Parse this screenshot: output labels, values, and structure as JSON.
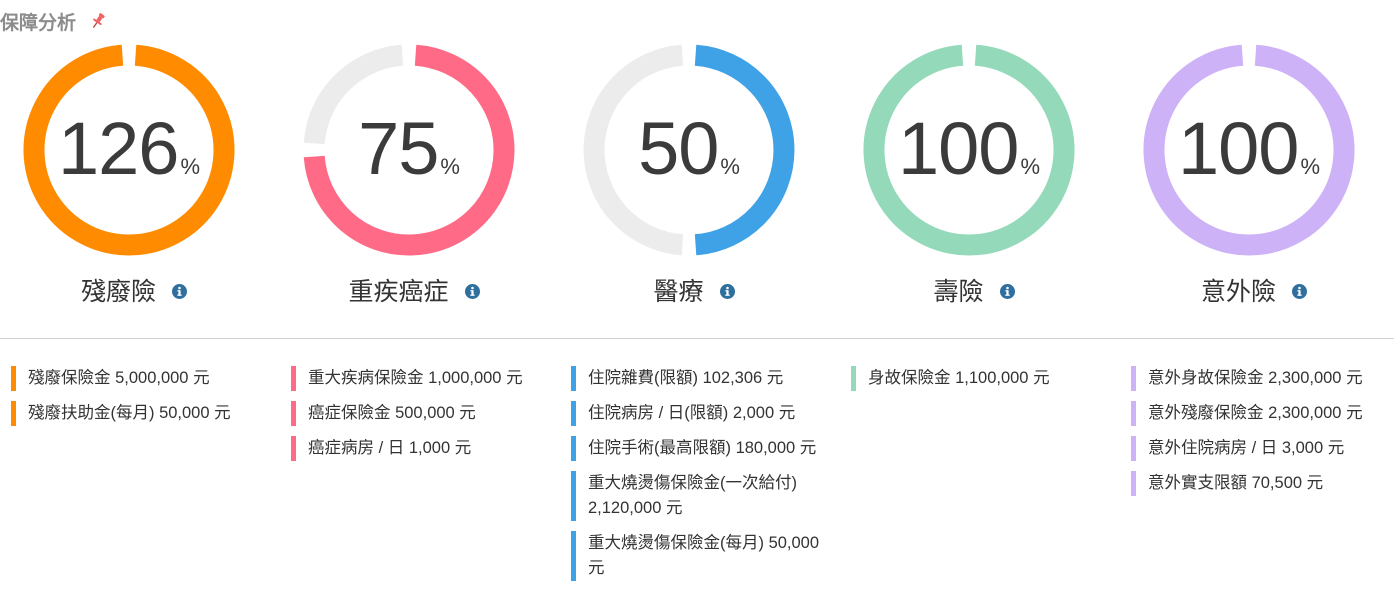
{
  "header": {
    "title": "保障分析",
    "pin_icon": "pin-icon"
  },
  "chart_data": {
    "type": "donut",
    "value_unit": "%",
    "series": [
      {
        "name": "殘廢險",
        "value": 126,
        "color": "#ff8c00",
        "track": "#ececec"
      },
      {
        "name": "重疾癌症",
        "value": 75,
        "color": "#ff6b87",
        "track": "#ececec"
      },
      {
        "name": "醫療",
        "value": 50,
        "color": "#3fa2e6",
        "track": "#ececec"
      },
      {
        "name": "壽險",
        "value": 100,
        "color": "#94d9ba",
        "track": "#ececec"
      },
      {
        "name": "意外險",
        "value": 100,
        "color": "#cdb2f7",
        "track": "#ececec"
      }
    ]
  },
  "details": [
    {
      "color": "#ff8c00",
      "items": [
        "殘廢保險金 5,000,000 元",
        "殘廢扶助金(每月) 50,000 元"
      ]
    },
    {
      "color": "#ff6b87",
      "items": [
        "重大疾病保險金 1,000,000 元",
        "癌症保險金 500,000 元",
        "癌症病房 / 日 1,000 元"
      ]
    },
    {
      "color": "#3fa2e6",
      "items": [
        "住院雜費(限額) 102,306 元",
        "住院病房 / 日(限額) 2,000 元",
        "住院手術(最高限額) 180,000 元",
        "重大燒燙傷保險金(一次給付) 2,120,000 元",
        "重大燒燙傷保險金(每月) 50,000 元"
      ]
    },
    {
      "color": "#94d9ba",
      "items": [
        "身故保險金 1,100,000 元"
      ]
    },
    {
      "color": "#cdb2f7",
      "items": [
        "意外身故保險金 2,300,000 元",
        "意外殘廢保險金 2,300,000 元",
        "意外住院病房 / 日 3,000 元",
        "意外實支限額 70,500 元"
      ]
    }
  ],
  "colors": {
    "info": "#2f6f9e",
    "pin": "#f06262"
  }
}
